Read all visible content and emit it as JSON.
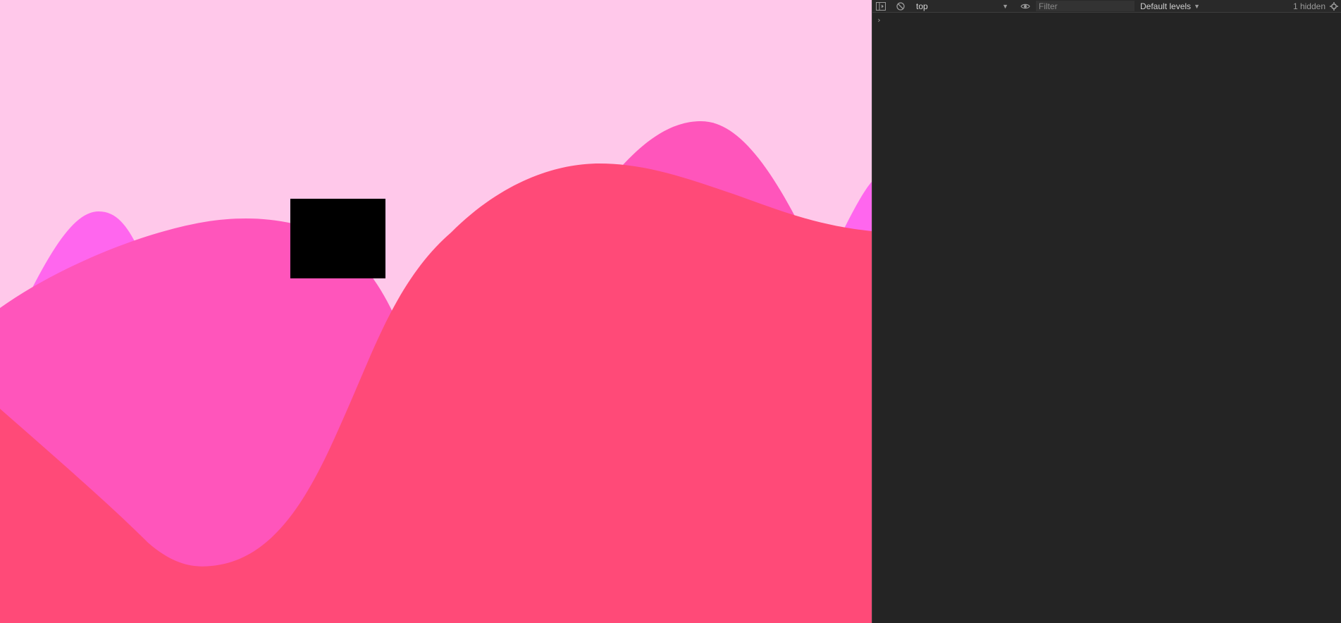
{
  "game": {
    "colors": {
      "sky": "#ffc8ea",
      "far_hill": "#ff66ee",
      "mid_hill": "#ff55bb",
      "front_hill": "#ff4a78",
      "player": "#000000"
    }
  },
  "devtools": {
    "toolbar": {
      "context": "top",
      "filter_placeholder": "Filter",
      "levels": "Default levels",
      "hidden": "1 hidden"
    },
    "console": {
      "prompt": "›"
    },
    "icons": {
      "sidebar": "sidebar-icon",
      "clear": "clear-console-icon",
      "context_dropdown": "dropdown-arrow-icon",
      "live_expression": "eye-icon",
      "levels_dropdown": "dropdown-arrow-icon",
      "settings": "gear-icon"
    }
  }
}
